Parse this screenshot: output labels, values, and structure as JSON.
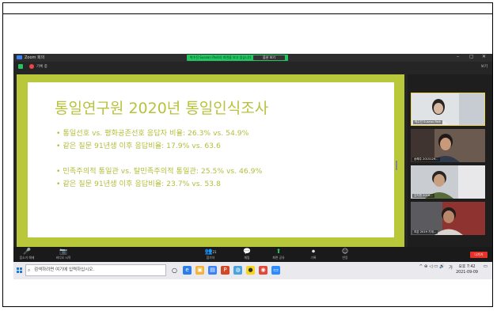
{
  "window": {
    "title": "Zoom 회의",
    "banner_text": "박수진 Susean Park의 화면을 보고 있습니다",
    "banner_button": "옵션 보기",
    "record_label": "기록 중",
    "view_label": "보기"
  },
  "slide": {
    "title": "통일연구원 2020년 통일인식조사",
    "bullets": [
      "• 통일선호 vs. 평화공존선호 응답자 비율: 26.3% vs. 54.9%",
      "• 같은 질문 91년생 이후 응답비율: 17.9% vs. 63.6",
      "• 민족주의적 통일관 vs. 탈민족주의적 통일관: 25.5% vs. 46.9%",
      "• 같은 질문 91년생 이후 응답비율: 23.7% vs. 53.8"
    ]
  },
  "participants": [
    {
      "name": "박수진 Susean Park",
      "active": true,
      "skin": "#d7b9a2",
      "bg": "#dfe3e6"
    },
    {
      "name": "송혜주 2015129...",
      "active": false,
      "skin": "#c99a7a",
      "bg": "#6b5a50"
    },
    {
      "name": "김지원 2016...",
      "active": false,
      "skin": "#c8a07f",
      "bg": "#c9ccd0"
    },
    {
      "name": "조은 2019 기계...",
      "active": false,
      "skin": "#b9876a",
      "bg": "#8f3330"
    }
  ],
  "toolbar": {
    "items": [
      {
        "name": "mute",
        "label": "음소거 해제",
        "icon": "🎤"
      },
      {
        "name": "video",
        "label": "비디오 시작",
        "icon": "📷"
      },
      {
        "name": "participants",
        "label": "참가자",
        "icon": "👥",
        "count": "21"
      },
      {
        "name": "chat",
        "label": "채팅",
        "icon": "💬"
      },
      {
        "name": "share",
        "label": "화면 공유",
        "icon": "⬆"
      },
      {
        "name": "record",
        "label": "기록",
        "icon": "⏺"
      },
      {
        "name": "reactions",
        "label": "반응",
        "icon": "☺"
      }
    ],
    "leave_label": "나가기"
  },
  "taskbar": {
    "search_placeholder": "검색하려면 여기에 입력하십시오.",
    "ime": "가",
    "time": "오후 7:42",
    "date": "2021-09-09",
    "tray_icons": "^ ⊕ ◁ ▭ 🔊"
  },
  "colors": {
    "slide_border": "#b9c83a",
    "slide_text": "#b2be3c",
    "banner": "#22c55e",
    "leave": "#e5332a"
  }
}
